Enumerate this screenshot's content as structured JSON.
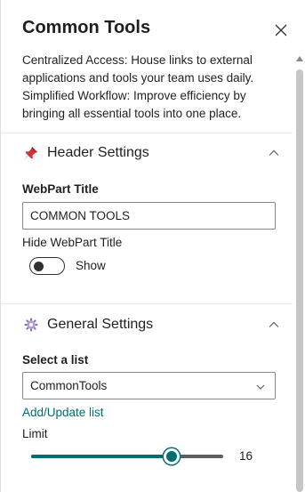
{
  "panel": {
    "title": "Common Tools",
    "description": "Centralized Access: House links to external applications and tools your team uses daily. Simplified Workflow: Improve efficiency by bringing all essential tools into one place."
  },
  "header_settings": {
    "title": "Header Settings",
    "icon": "pushpin-icon",
    "webpart_title_label": "WebPart Title",
    "webpart_title_value": "COMMON TOOLS",
    "hide_title_label": "Hide WebPart Title",
    "hide_title_toggle_state": "Show",
    "hide_title_on": false
  },
  "general_settings": {
    "title": "General Settings",
    "icon": "gear-icon",
    "select_list_label": "Select a list",
    "select_list_value": "CommonTools",
    "add_update_link": "Add/Update list",
    "limit_label": "Limit",
    "limit_value": "16",
    "limit_fraction": 0.73
  },
  "colors": {
    "accent": "#036c70",
    "text": "#201f1e",
    "border": "#8a8886"
  }
}
